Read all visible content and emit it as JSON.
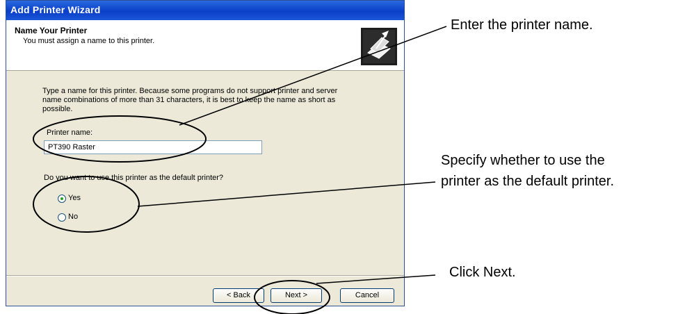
{
  "window": {
    "title": "Add Printer Wizard"
  },
  "header": {
    "title": "Name Your Printer",
    "subtitle": "You must assign a name to this printer.",
    "icon": "printer-pen-icon"
  },
  "body": {
    "description_line1": "Type a name for this printer. Because some programs do not support printer and server",
    "description_line2": "name combinations of more than 31 characters, it is best to keep the name as short as",
    "description_line3": "possible.",
    "printer_name_label": "Printer name:",
    "printer_name_value": "PT390 Raster",
    "default_question": "Do you want to use this printer as the default printer?",
    "options": [
      {
        "label": "Yes",
        "selected": true
      },
      {
        "label": "No",
        "selected": false
      }
    ]
  },
  "buttons": {
    "back": "< Back",
    "next": "Next >",
    "cancel": "Cancel"
  },
  "callouts": {
    "name": "Enter the printer name.",
    "default_line1": "Specify whether to use the",
    "default_line2": "printer as the default printer.",
    "next": "Click Next."
  }
}
